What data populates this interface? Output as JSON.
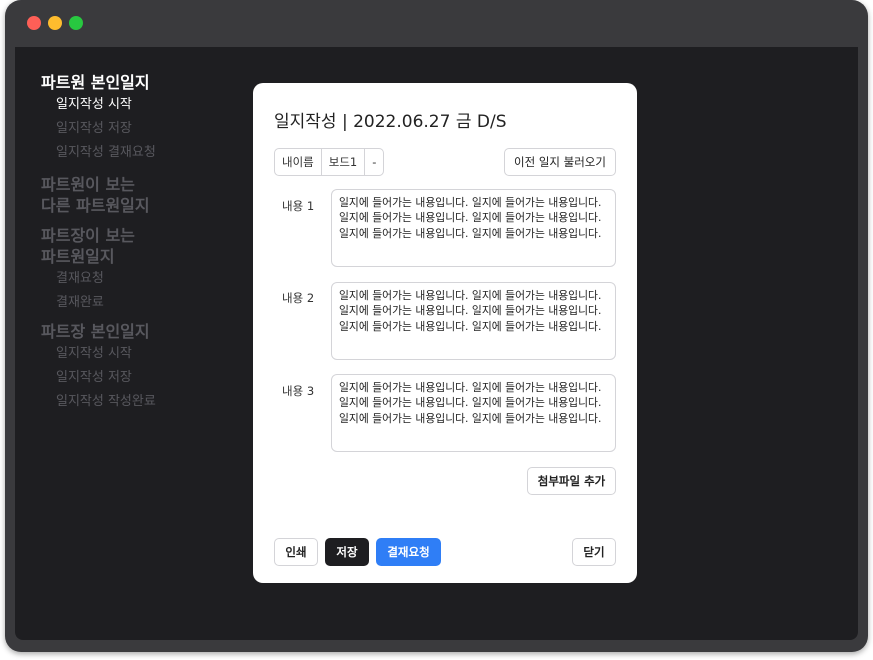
{
  "sidebar": {
    "sections": [
      {
        "title": "파트원 본인일지",
        "items": [
          "일지작성 시작",
          "일지작성 저장",
          "일지작성 결재요청"
        ]
      },
      {
        "title_line1": "파트원이 보는",
        "title_line2": "다른 파트원일지"
      },
      {
        "title_line1": "파트장이 보는",
        "title_line2": "파트원일지",
        "items": [
          "결재요청",
          "결재완료"
        ]
      },
      {
        "title": "파트장 본인일지",
        "items": [
          "일지작성 시작",
          "일지작성 저장",
          "일지작성 작성완료"
        ]
      }
    ]
  },
  "modal": {
    "title": "일지작성 | 2022.06.27 금 D/S",
    "segments": [
      "내이름",
      "보드1",
      "-"
    ],
    "load_previous_label": "이전 일지 불러오기",
    "rows": [
      {
        "label": "내용 1",
        "text": "일지에 들어가는 내용입니다. 일지에 들어가는 내용입니다. 일지에 들어가는 내용입니다. 일지에 들어가는 내용입니다. 일지에 들어가는 내용입니다. 일지에 들어가는 내용입니다."
      },
      {
        "label": "내용 2",
        "text": "일지에 들어가는 내용입니다. 일지에 들어가는 내용입니다. 일지에 들어가는 내용입니다. 일지에 들어가는 내용입니다. 일지에 들어가는 내용입니다. 일지에 들어가는 내용입니다."
      },
      {
        "label": "내용 3",
        "text": "일지에 들어가는 내용입니다. 일지에 들어가는 내용입니다. 일지에 들어가는 내용입니다. 일지에 들어가는 내용입니다. 일지에 들어가는 내용입니다. 일지에 들어가는 내용입니다."
      }
    ],
    "attach_label": "첨부파일 추가",
    "print_label": "인쇄",
    "save_label": "저장",
    "approval_label": "결재요청",
    "close_label": "닫기"
  },
  "colors": {
    "accent": "#2f7ef6",
    "dark_button": "#1e1e21",
    "background": "#1e1e21",
    "sidebar_muted": "#58585e"
  }
}
